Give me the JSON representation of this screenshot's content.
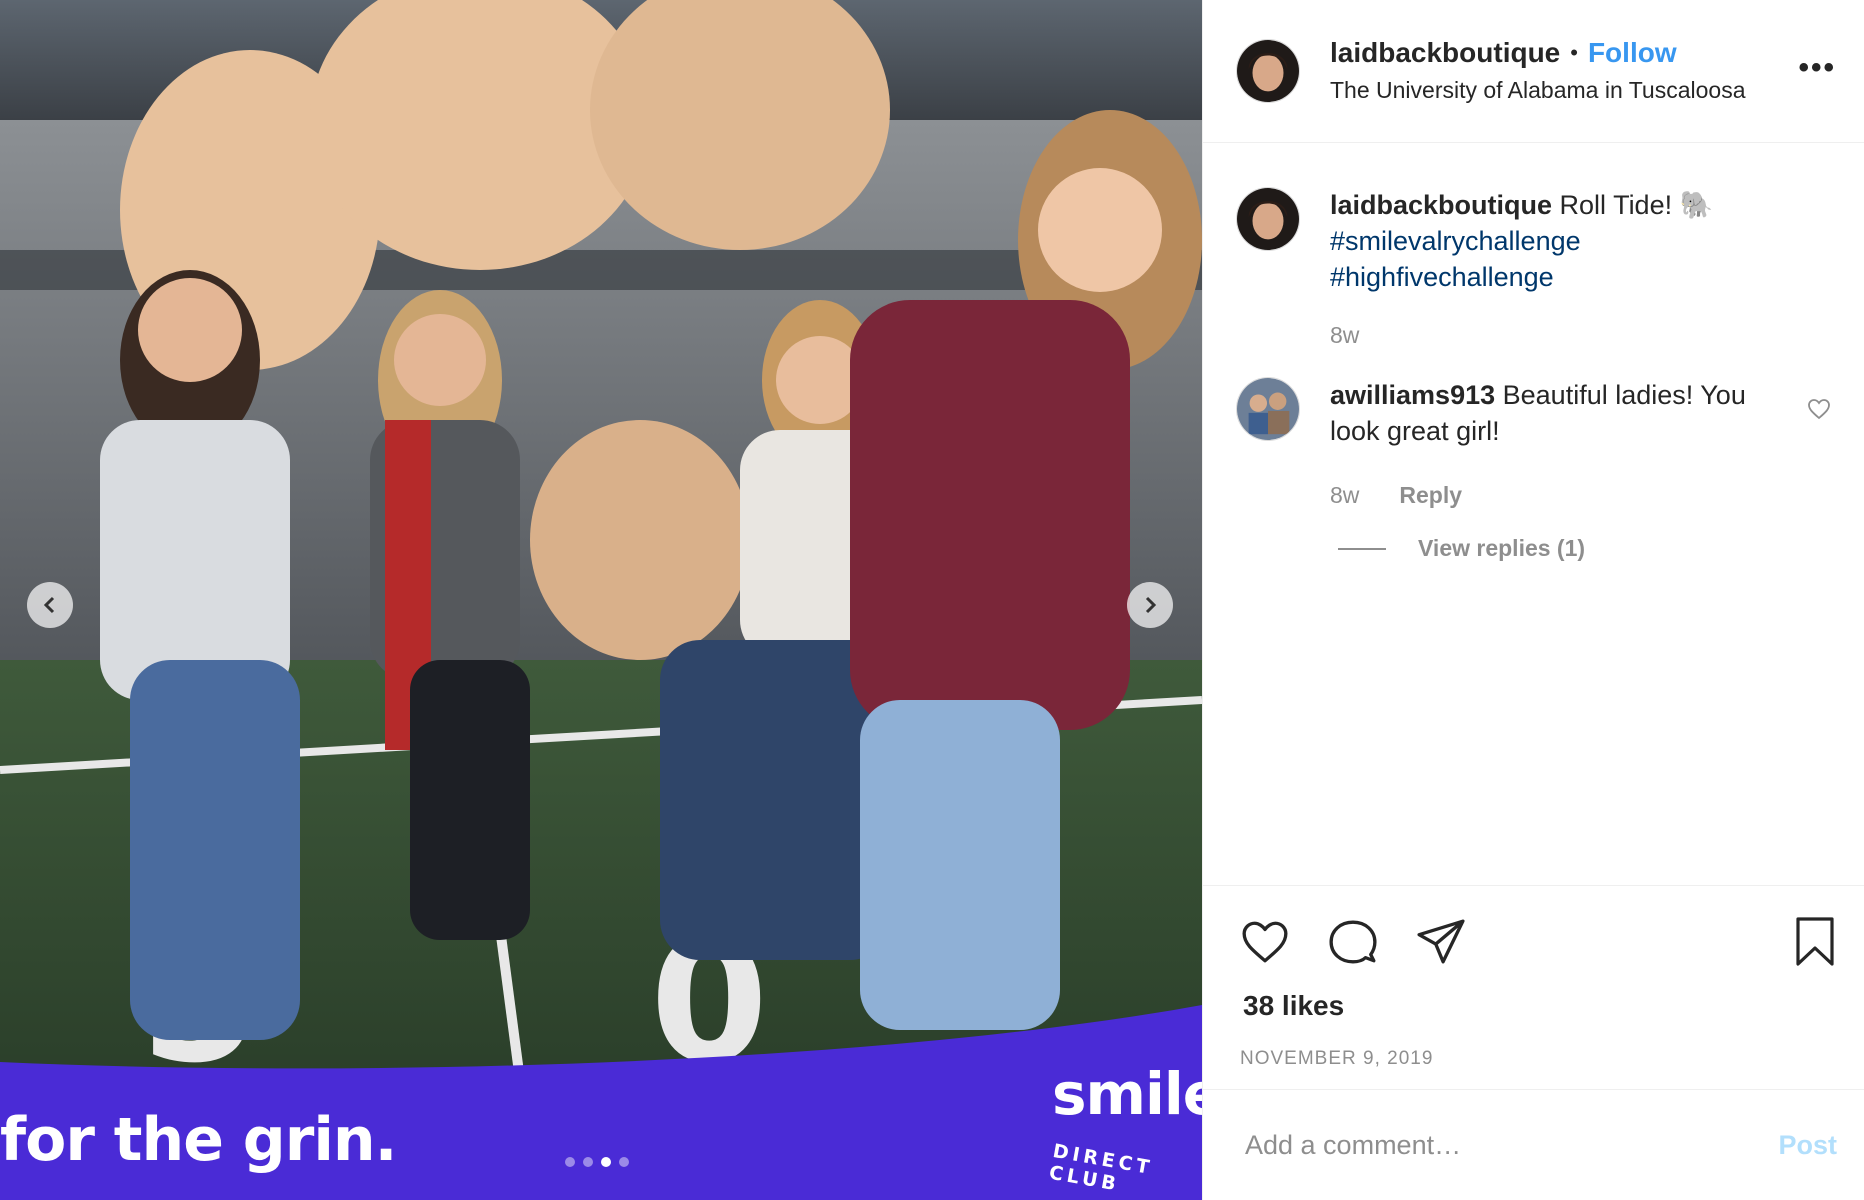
{
  "media": {
    "banner_text": "for the grin.",
    "brand_word": "smile",
    "brand_sub": "DIRECT CLUB",
    "carousel_count": 4,
    "carousel_active_index": 2,
    "banner_color": "#4a2bd6"
  },
  "header": {
    "username": "laidbackboutique",
    "separator": "•",
    "follow_label": "Follow",
    "location": "The University of Alabama in Tuscaloosa",
    "more_label": "•••"
  },
  "caption": {
    "username": "laidbackboutique",
    "text": "Roll Tide! 🐘",
    "hashtags": [
      "#smilevalrychallenge",
      "#highfivechallenge"
    ],
    "time": "8w"
  },
  "comments": [
    {
      "username": "awilliams913",
      "text": "Beautiful ladies! You look great girl!",
      "time": "8w",
      "reply_label": "Reply",
      "view_replies_label": "View replies (1)"
    }
  ],
  "footer": {
    "likes": "38 likes",
    "date": "NOVEMBER 9, 2019",
    "comment_placeholder": "Add a comment…",
    "post_label": "Post"
  },
  "colors": {
    "link_blue": "#3897f0",
    "hashtag": "#00376b",
    "muted": "#8e8e8e"
  }
}
